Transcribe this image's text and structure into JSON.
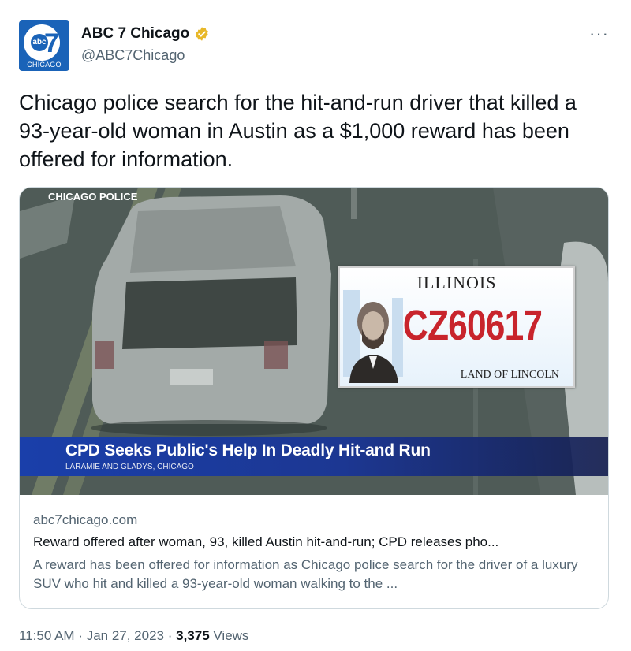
{
  "account": {
    "display_name": "ABC 7 Chicago",
    "handle": "@ABC7Chicago",
    "avatar": {
      "brand": "abc",
      "number": "7",
      "city": "CHICAGO"
    },
    "verified_icon": "gold-verified-badge",
    "more_icon": "···"
  },
  "tweet": {
    "text": "Chicago police search for the hit-and-run driver that killed a 93-year-old woman in Austin as a $1,000 reward has been offered for information."
  },
  "card": {
    "media": {
      "overlay_label": "CHICAGO POLICE",
      "plate": {
        "state": "ILLINOIS",
        "number": "CZ60617",
        "slogan": "LAND OF LINCOLN"
      },
      "banner_headline": "CPD Seeks Public's Help In Deadly Hit-and Run",
      "banner_location": "LARAMIE AND GLADYS, CHICAGO"
    },
    "domain": "abc7chicago.com",
    "title": "Reward offered after woman, 93, killed Austin hit-and-run; CPD releases pho...",
    "description": "A reward has been offered for information as Chicago police search for the driver of a luxury SUV who hit and killed a 93-year-old woman walking to the ..."
  },
  "meta": {
    "time": "11:50 AM",
    "separator": " · ",
    "date": "Jan 27, 2023",
    "views_count": "3,375",
    "views_label": " Views"
  },
  "colors": {
    "brand_blue": "#1a63b8",
    "verified_gold": "#e8b829",
    "secondary_text": "#536471",
    "banner_blue": "#1a3faa",
    "plate_red": "#c8242c"
  }
}
